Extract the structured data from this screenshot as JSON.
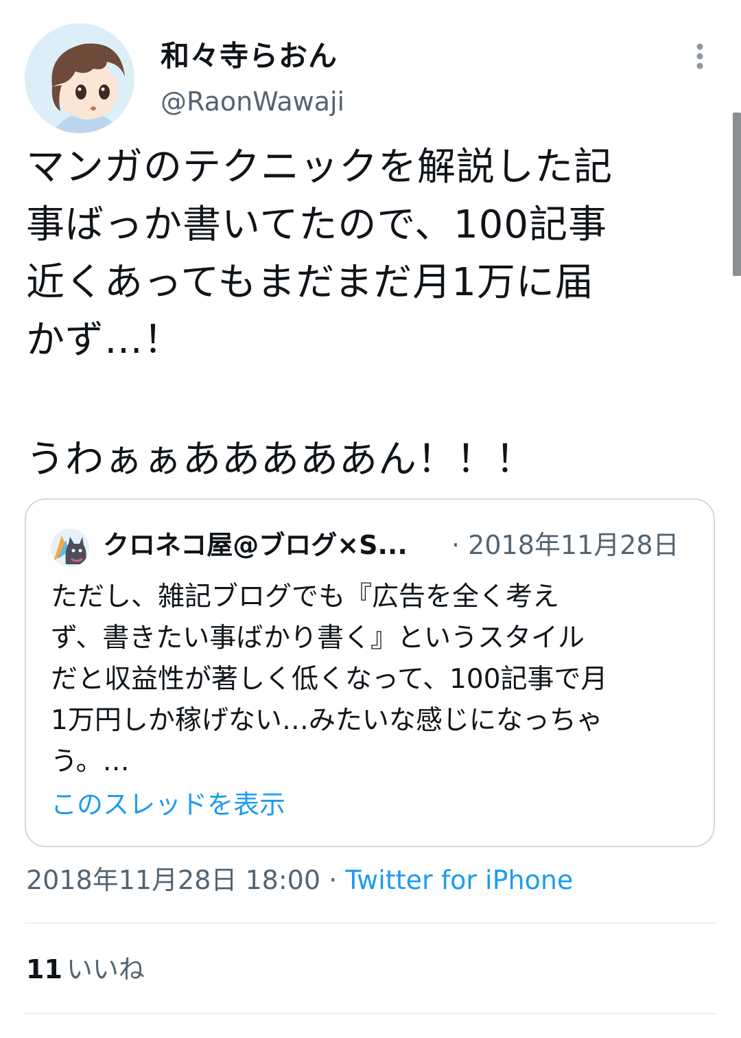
{
  "author": {
    "display_name": "和々寺らおん",
    "handle": "@RaonWawaji",
    "avatar_icon": "anime-boy-avatar"
  },
  "more_icon": "more-vertical-icon",
  "tweet": {
    "text": "マンガのテクニックを解説した記\n事ばっか書いてたので、100記事\n近くあってもまだまだ月1万に届\nかず…！",
    "exclaim": "うわぁぁあああああん！！！"
  },
  "quote": {
    "avatar_icon": "black-cat-avatar",
    "author_name": "クロネコ屋@ブログ×S...",
    "meta": "· 2018年11月28日",
    "text": "ただし、雑記ブログでも『広告を全く考え\nず、書きたい事ばかり書く』というスタイル\nだと収益性が著しく低くなって、100記事で月\n1万円しか稼げない…みたいな感じになっちゃ\nう。…",
    "show_thread": "このスレッドを表示"
  },
  "meta": {
    "timestamp": "2018年11月28日 18:00 · ",
    "source": "Twitter for iPhone"
  },
  "likes": {
    "count": "11",
    "label": "いいね"
  },
  "colors": {
    "link": "#1d9bf0",
    "secondary_text": "#536471",
    "border": "#cfd9de"
  }
}
